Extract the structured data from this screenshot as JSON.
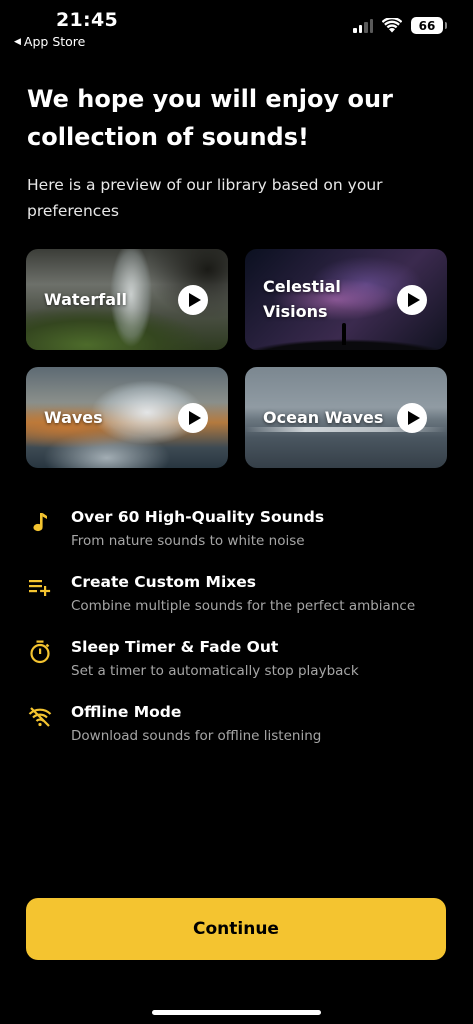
{
  "status_bar": {
    "time": "21:45",
    "back_app": "App Store",
    "battery": "66"
  },
  "header": {
    "title": "We hope you will enjoy our collection of sounds!",
    "subtitle": "Here is a preview of our library based on your preferences"
  },
  "sounds": [
    {
      "label": "Waterfall"
    },
    {
      "label": "Celestial Visions"
    },
    {
      "label": "Waves"
    },
    {
      "label": "Ocean Waves"
    }
  ],
  "features": [
    {
      "icon": "music-note-icon",
      "title": "Over 60 High-Quality Sounds",
      "description": "From nature sounds to white noise"
    },
    {
      "icon": "playlist-add-icon",
      "title": "Create Custom Mixes",
      "description": "Combine multiple sounds for the perfect ambiance"
    },
    {
      "icon": "timer-icon",
      "title": "Sleep Timer & Fade Out",
      "description": "Set a timer to automatically stop playback"
    },
    {
      "icon": "wifi-off-icon",
      "title": "Offline Mode",
      "description": "Download sounds for offline listening"
    }
  ],
  "continue_label": "Continue",
  "colors": {
    "accent": "#f4c430",
    "background": "#000000",
    "secondary_text": "#a6a6a6"
  }
}
